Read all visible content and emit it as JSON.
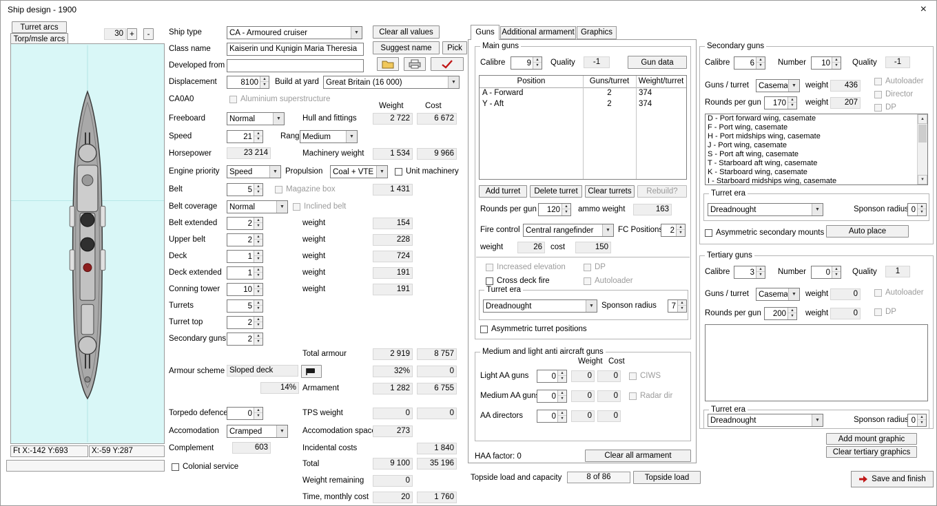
{
  "icons": {
    "up": "▲",
    "down": "▼",
    "dropdown": "▼",
    "close": "×"
  },
  "window": {
    "title": "Ship design - 1900"
  },
  "left": {
    "turret_arcs": "Turret arcs",
    "torp_arcs": "Torp/msle arcs",
    "angle": "30",
    "plus": "+",
    "minus": "-",
    "status_left": "Ft X:-142 Y:693",
    "status_right": "X:-59 Y:287"
  },
  "mid": {
    "clear_all": "Clear all values",
    "suggest_name": "Suggest name",
    "pick": "Pick"
  },
  "form": {
    "ship_type": "Ship type",
    "ship_type_val": "CA - Armoured cruiser",
    "class_name": "Class name",
    "class_name_val": "Kaiserin und Kųnigin Maria Theresia",
    "developed_from": "Developed from",
    "developed_val": "",
    "displacement": "Displacement",
    "displacement_val": "8100",
    "build_at_yard": "Build at yard",
    "yard_val": "Great Britain (16 000)",
    "hull_code": "CA0A0",
    "aluminium": "Aluminium superstructure",
    "weight_hdr": "Weight",
    "cost_hdr": "Cost",
    "freeboard": "Freeboard",
    "freeboard_val": "Normal",
    "hull_fittings": "Hull and fittings",
    "hull_w": "2 722",
    "hull_c": "6 672",
    "speed": "Speed",
    "speed_val": "21",
    "range": "Range",
    "range_val": "Medium",
    "horsepower": "Horsepower",
    "horsepower_val": "23 214",
    "machinery": "Machinery weight",
    "mach_w": "1 534",
    "mach_c": "9 966",
    "engine_priority": "Engine priority",
    "engine_val": "Speed",
    "propulsion": "Propulsion",
    "propulsion_val": "Coal + VTE",
    "unit_machinery": "Unit machinery",
    "belt": "Belt",
    "belt_val": "5",
    "magazine_box": "Magazine box",
    "belt_w": "1 431",
    "belt_coverage": "Belt coverage",
    "belt_cov_val": "Normal",
    "inclined_belt": "Inclined belt",
    "belt_ext": "Belt extended",
    "belt_ext_val": "2",
    "weight_lbl": "weight",
    "belt_ext_w": "154",
    "upper_belt": "Upper belt",
    "upper_belt_val": "2",
    "upper_belt_w": "228",
    "deck": "Deck",
    "deck_val": "1",
    "deck_w": "724",
    "deck_ext": "Deck extended",
    "deck_ext_val": "1",
    "deck_ext_w": "191",
    "conning": "Conning tower",
    "conning_val": "10",
    "conning_w": "191",
    "turrets": "Turrets",
    "turrets_val": "5",
    "turret_top": "Turret top",
    "turret_top_val": "2",
    "secondary_guns": "Secondary guns",
    "secondary_guns_val": "2",
    "total_armour": "Total armour",
    "armour_w": "2 919",
    "armour_c": "8 757",
    "armour_scheme": "Armour scheme",
    "armour_scheme_val": "Sloped deck",
    "armour_pct": "32%",
    "armour_pct_c": "0",
    "pct14": "14%",
    "armament": "Armament",
    "armament_w": "1 282",
    "armament_c": "6 755",
    "torpedo_def": "Torpedo defence",
    "torpedo_val": "0",
    "tps": "TPS weight",
    "tps_w": "0",
    "tps_c": "0",
    "accomodation": "Accomodation",
    "accomodation_val": "Cramped",
    "accom_space": "Accomodation space",
    "accom_space_val": "273",
    "complement": "Complement",
    "complement_val": "603",
    "incidental": "Incidental costs",
    "incidental_c": "1 840",
    "colonial": "Colonial service",
    "total": "Total",
    "total_w": "9 100",
    "total_c": "35 196",
    "weight_rem": "Weight remaining",
    "weight_rem_val": "0",
    "time_cost": "Time, monthly cost",
    "time_w": "20",
    "time_c": "1 760"
  },
  "tabs": {
    "guns": "Guns",
    "additional": "Additional armament",
    "graphics": "Graphics"
  },
  "main_guns": {
    "title": "Main guns",
    "calibre": "Calibre",
    "calibre_val": "9",
    "quality": "Quality",
    "quality_val": "-1",
    "gun_data": "Gun data",
    "table": {
      "h": [
        "Position",
        "Guns/turret",
        "Weight/turret"
      ],
      "rows": [
        [
          "A - Forward",
          "2",
          "374"
        ],
        [
          "Y - Aft",
          "2",
          "374"
        ]
      ]
    },
    "add_turret": "Add turret",
    "delete_turret": "Delete turret",
    "clear_turrets": "Clear turrets",
    "rebuild": "Rebuild?",
    "rounds": "Rounds per gun",
    "rounds_val": "120",
    "ammo_weight": "ammo weight",
    "ammo_val": "163",
    "fire_control": "Fire control",
    "fc_val": "Central rangefinder",
    "fc_positions": "FC Positions",
    "fc_pos_val": "2",
    "weight_lbl": "weight",
    "weight_val": "26",
    "cost_lbl": "cost",
    "cost_val": "150",
    "incr_elev": "Increased elevation",
    "dp": "DP",
    "cross_deck": "Cross deck fire",
    "autoloader": "Autoloader",
    "turret_era": "Turret era",
    "era_val": "Dreadnought",
    "sponson": "Sponson radius",
    "sponson_val": "7",
    "asym": "Asymmetric turret positions"
  },
  "aa": {
    "title": "Medium and light anti aircraft guns",
    "weight_hdr": "Weight",
    "cost_hdr": "Cost",
    "light": "Light AA guns",
    "light_val": "0",
    "light_w": "0",
    "light_c": "0",
    "ciws": "CIWS",
    "medium": "Medium AA guns",
    "medium_val": "0",
    "medium_w": "0",
    "medium_c": "0",
    "radar": "Radar dir",
    "directors": "AA directors",
    "dir_val": "0",
    "dir_w": "0",
    "dir_c": "0"
  },
  "footer": {
    "haa": "HAA factor: 0",
    "clear_armament": "Clear all armament",
    "topside_label": "Topside load and capacity",
    "topside_val": "8 of 86",
    "topside_btn": "Topside load"
  },
  "secondary": {
    "title": "Secondary guns",
    "calibre": "Calibre",
    "calibre_val": "6",
    "number": "Number",
    "number_val": "10",
    "quality": "Quality",
    "quality_val": "-1",
    "guns_turret": "Guns / turret",
    "mount_val": "Casemat",
    "weight_lbl": "weight",
    "mount_w": "436",
    "autoloader": "Autoloader",
    "director": "Director",
    "rounds": "Rounds per gun",
    "rounds_val": "170",
    "rounds_w": "207",
    "dp": "DP",
    "positions": [
      "D - Port forward wing, casemate",
      "F - Port wing, casemate",
      "H - Port midships wing, casemate",
      "J - Port wing, casemate",
      "S - Port aft wing, casemate",
      "T - Starboard aft wing, casemate",
      "K - Starboard wing, casemate",
      "I - Starboard midships wing, casemate"
    ],
    "turret_era": "Turret era",
    "era_val": "Dreadnought",
    "sponson": "Sponson radius",
    "sponson_val": "0",
    "asym": "Asymmetric secondary mounts",
    "auto_place": "Auto place"
  },
  "tertiary": {
    "title": "Tertiary guns",
    "calibre": "Calibre",
    "calibre_val": "3",
    "number": "Number",
    "number_val": "0",
    "quality": "Quality",
    "quality_val": "1",
    "guns_turret": "Guns / turret",
    "mount_val": "Casemat",
    "weight_lbl": "weight",
    "mount_w": "0",
    "autoloader": "Autoloader",
    "rounds": "Rounds per gun",
    "rounds_val": "200",
    "rounds_w": "0",
    "dp": "DP",
    "turret_era": "Turret era",
    "era_val": "Dreadnought",
    "sponson": "Sponson radius",
    "sponson_val": "0",
    "add_mount": "Add mount graphic",
    "clear_graphics": "Clear tertiary graphics"
  },
  "save_label": "Save and finish"
}
